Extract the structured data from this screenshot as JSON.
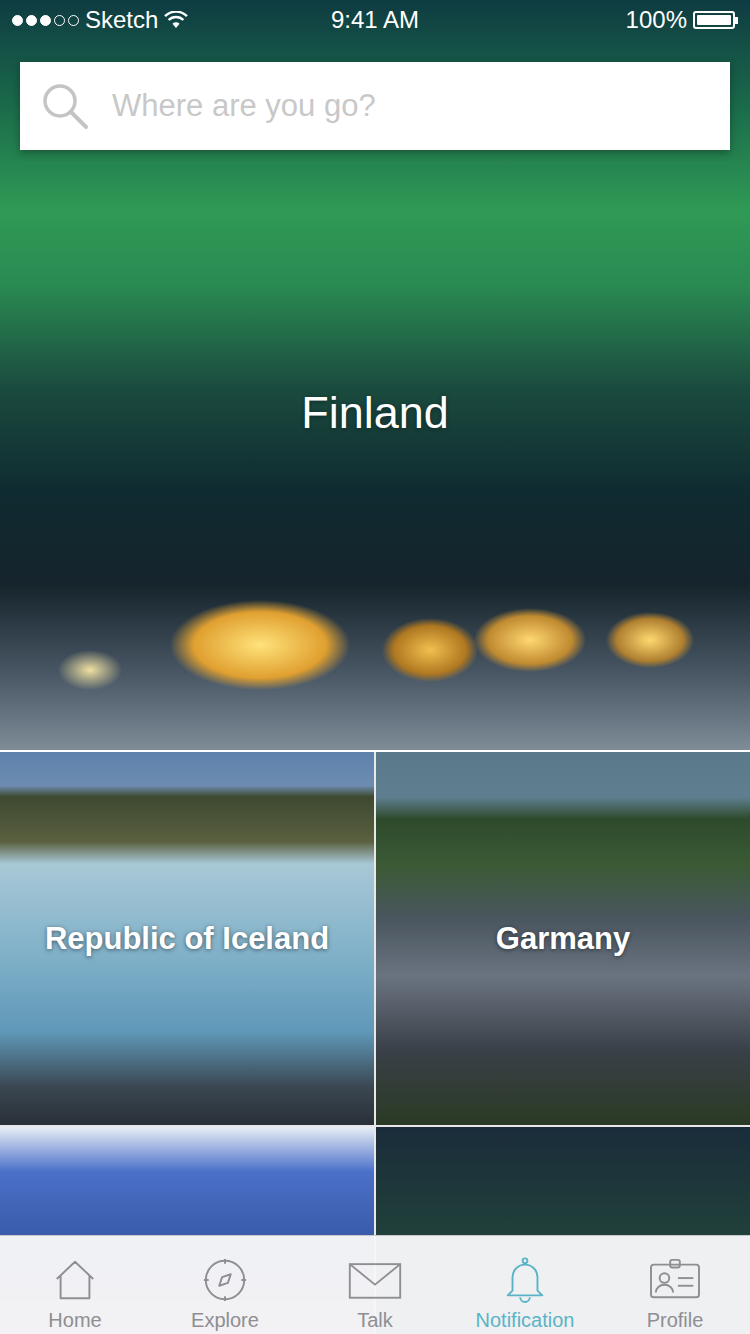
{
  "status_bar": {
    "carrier": "Sketch",
    "signal": {
      "filled": 3,
      "total": 5
    },
    "time": "9:41 AM",
    "battery": "100%",
    "battery_level": 1
  },
  "search": {
    "placeholder": "Where are you go?"
  },
  "featured": {
    "name": "Finland"
  },
  "destinations": [
    {
      "name": "Republic of Iceland"
    },
    {
      "name": "Garmany"
    }
  ],
  "tabs": [
    {
      "label": "Home",
      "selected": false
    },
    {
      "label": "Explore",
      "selected": false
    },
    {
      "label": "Talk",
      "selected": false
    },
    {
      "label": "Notification",
      "selected": true
    },
    {
      "label": "Profile",
      "selected": false
    }
  ]
}
